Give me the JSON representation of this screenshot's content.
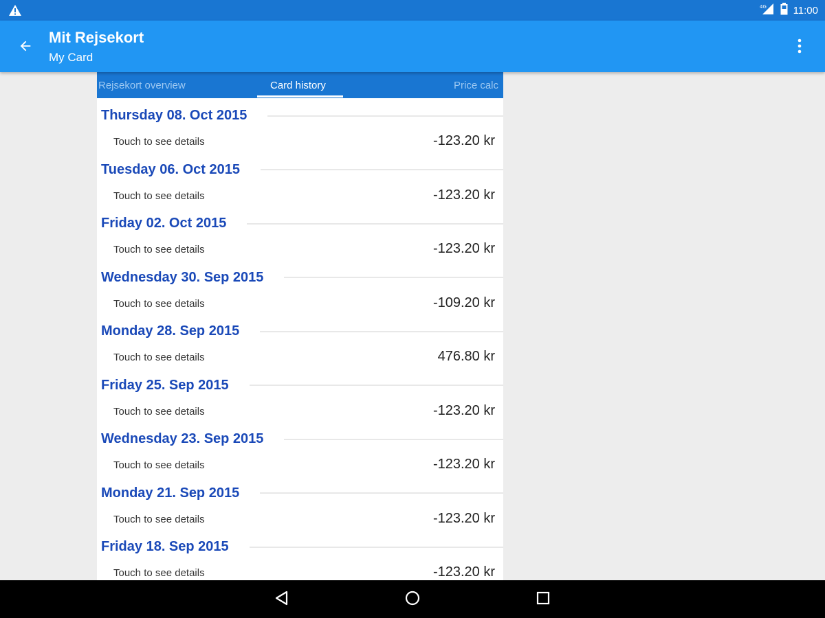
{
  "status": {
    "time": "11:00",
    "signal_label": "4G"
  },
  "app_bar": {
    "title": "Mit Rejsekort",
    "subtitle": "My Card"
  },
  "tabs": [
    {
      "label": "Rejsekort overview"
    },
    {
      "label": "Card history"
    },
    {
      "label": "Price calc"
    }
  ],
  "history": [
    {
      "date": "Thursday 08. Oct 2015",
      "detail": "Touch to see details",
      "amount": "-123.20 kr"
    },
    {
      "date": "Tuesday 06. Oct 2015",
      "detail": "Touch to see details",
      "amount": "-123.20 kr"
    },
    {
      "date": "Friday 02. Oct 2015",
      "detail": "Touch to see details",
      "amount": "-123.20 kr"
    },
    {
      "date": "Wednesday 30. Sep 2015",
      "detail": "Touch to see details",
      "amount": "-109.20 kr"
    },
    {
      "date": "Monday 28. Sep 2015",
      "detail": "Touch to see details",
      "amount": "476.80 kr"
    },
    {
      "date": "Friday 25. Sep 2015",
      "detail": "Touch to see details",
      "amount": "-123.20 kr"
    },
    {
      "date": "Wednesday 23. Sep 2015",
      "detail": "Touch to see details",
      "amount": "-123.20 kr"
    },
    {
      "date": "Monday 21. Sep 2015",
      "detail": "Touch to see details",
      "amount": "-123.20 kr"
    },
    {
      "date": "Friday 18. Sep 2015",
      "detail": "Touch to see details",
      "amount": "-123.20 kr"
    }
  ],
  "colors": {
    "status_bar": "#1976d2",
    "app_bar": "#2196f3",
    "date_text": "#1a49b8"
  },
  "icons": {
    "status_warning": "warning-icon",
    "status_signal": "signal-icon",
    "status_battery": "battery-icon",
    "back": "arrow-back-icon",
    "overflow": "more-vert-icon",
    "nav_back": "nav-back-icon",
    "nav_home": "nav-home-icon",
    "nav_recents": "nav-recents-icon"
  }
}
